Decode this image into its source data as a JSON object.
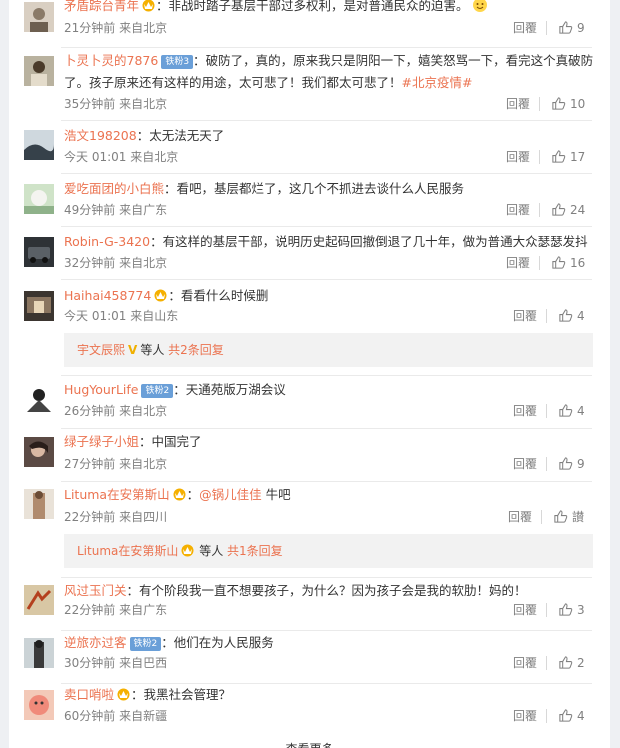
{
  "comments": [
    {
      "user": "矛盾踪台青年",
      "colon": "：",
      "text": "非战时踏子基层干部过多权利，是对普通民众的迫害。",
      "time": "21分钟前",
      "location": "来自北京",
      "reply": "回覆",
      "likes": "9"
    },
    {
      "user": "卜灵卜灵的7876",
      "badge": "铁粉3",
      "colon": "：",
      "text": "破防了，真的，原来我只是阴阳一下，嬉笑怒骂一下，看完这个真破防",
      "text2": "了。孩子原来还有这样的用途，太可悲了！我们都太可悲了！",
      "hashtag": "#北京疫情#",
      "time": "35分钟前",
      "location": "来自北京",
      "reply": "回覆",
      "likes": "10"
    },
    {
      "user": "浩文198208",
      "colon": "：",
      "text": "太无法无天了",
      "time": "今天 01:01",
      "location": "来自北京",
      "reply": "回覆",
      "likes": "17"
    },
    {
      "user": "爱吃面团的小白熊",
      "colon": "：",
      "text": "看吧，基层都烂了，这几个不抓进去谈什么人民服务",
      "time": "49分钟前",
      "location": "来自广东",
      "reply": "回覆",
      "likes": "24"
    },
    {
      "user": "Robin-G-3420",
      "colon": "：",
      "text": "有这样的基层干部，说明历史起码回撤倒退了几十年，做为普通大众瑟瑟发抖",
      "time": "32分钟前",
      "location": "来自北京",
      "reply": "回覆",
      "likes": "16"
    },
    {
      "user": "Haihai458774",
      "colon": "：",
      "text": "看看什么时候删",
      "time": "今天 01:01",
      "location": "来自山东",
      "reply": "回覆",
      "likes": "4"
    },
    {
      "user": "HugYourLife",
      "badge": "铁粉2",
      "colon": "：",
      "text": "天通苑版万湖会议",
      "time": "26分钟前",
      "location": "来自北京",
      "reply": "回覆",
      "likes": "4"
    },
    {
      "user": "绿子绿子小姐",
      "colon": "：",
      "text": "中国完了",
      "time": "27分钟前",
      "location": "来自北京",
      "reply": "回覆",
      "likes": "9"
    },
    {
      "user": "Lituma在安第斯山",
      "colon": "：",
      "mention": "@锅儿佳佳",
      "text": " 牛吧",
      "time": "22分钟前",
      "location": "来自四川",
      "reply": "回覆",
      "likes": "讃"
    },
    {
      "user": "风过玉门关",
      "colon": "：",
      "text": "有个阶段我一直不想要孩子，为什么？因为孩子会是我的软肋！妈的！",
      "time": "22分钟前",
      "location": "来自广东",
      "reply": "回覆",
      "likes": "3"
    },
    {
      "user": "逆旅亦过客",
      "badge": "铁粉2",
      "colon": "：",
      "text": "他们在为人民服务",
      "time": "30分钟前",
      "location": "来自巴西",
      "reply": "回覆",
      "likes": "2"
    },
    {
      "user": "卖口哨啦",
      "colon": "：",
      "text": "我黑社会管理？",
      "time": "60分钟前",
      "location": "来自新疆",
      "reply": "回覆",
      "likes": "4"
    }
  ],
  "more_replies": [
    {
      "user": "宇文辰熙",
      "mid": "等人",
      "count": "共2条回复"
    },
    {
      "user": "Lituma在安第斯山",
      "mid": "等人",
      "count": "共1条回复"
    }
  ],
  "view_more": "查看更多",
  "icons": {
    "like": "thumbs-up-icon",
    "crown": "crown-icon",
    "verified": "v-badge-icon"
  },
  "colors": {
    "username": "#eb7350",
    "meta": "#808080",
    "reply_bg": "#f2f2f2",
    "badge": "#6a9fd8"
  }
}
